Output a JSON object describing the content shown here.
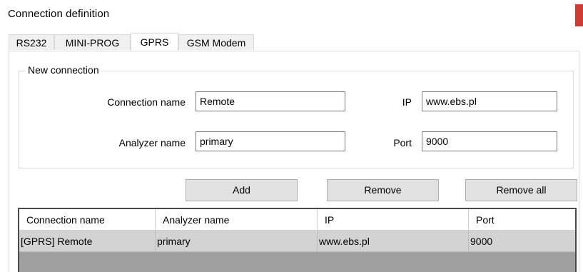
{
  "window": {
    "title": "Connection definition"
  },
  "tabs": [
    {
      "label": "RS232"
    },
    {
      "label": "MINI-PROG"
    },
    {
      "label": "GPRS",
      "active": true
    },
    {
      "label": "GSM Modem"
    }
  ],
  "new_connection": {
    "group_label": "New connection",
    "connection_name_label": "Connection name",
    "connection_name_value": "Remote",
    "analyzer_name_label": "Analyzer name",
    "analyzer_name_value": "primary",
    "ip_label": "IP",
    "ip_value": "www.ebs.pl",
    "port_label": "Port",
    "port_value": "9000"
  },
  "buttons": {
    "add": "Add",
    "remove": "Remove",
    "remove_all": "Remove all"
  },
  "table": {
    "columns": [
      "Connection name",
      "Analyzer name",
      "IP",
      "Port"
    ],
    "rows": [
      [
        "[GPRS] Remote",
        "primary",
        "www.ebs.pl",
        "9000"
      ]
    ]
  },
  "colors": {
    "close_accent": "#cc3b35",
    "selected_row": "#d3d3d3",
    "grid_empty_area": "#a0a0a0"
  }
}
